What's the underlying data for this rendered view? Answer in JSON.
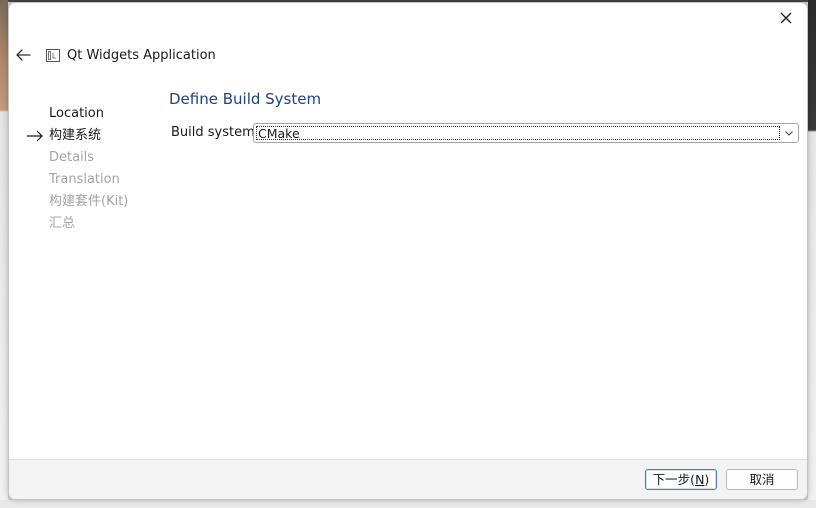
{
  "window": {
    "close_label": "Close"
  },
  "header": {
    "title": "Qt Widgets Application"
  },
  "steps": [
    {
      "label": "Location",
      "state": "done"
    },
    {
      "label": "构建系统",
      "state": "current"
    },
    {
      "label": "Details",
      "state": "pending"
    },
    {
      "label": "Translation",
      "state": "pending"
    },
    {
      "label": "构建套件(Kit)",
      "state": "pending"
    },
    {
      "label": "汇总",
      "state": "pending"
    }
  ],
  "page": {
    "title": "Define Build System",
    "build_system_label": "Build system:",
    "build_system_value": "CMake"
  },
  "footer": {
    "next_prefix": "下一步(",
    "next_mnemonic": "N",
    "next_suffix": ")",
    "cancel_label": "取消"
  },
  "colors": {
    "page_title": "#1f3f86",
    "pending_step": "#a3a3a3",
    "default_button_border": "#4a7bbd"
  }
}
